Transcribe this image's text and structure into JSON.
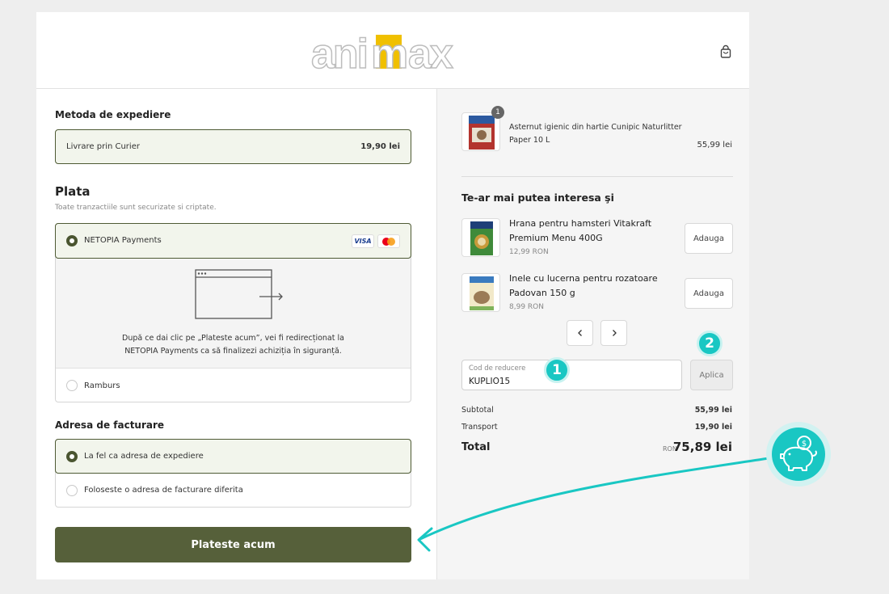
{
  "store": {
    "logo_text": "animax"
  },
  "shipping": {
    "title": "Metoda de expediere",
    "method": "Livrare prin Curier",
    "price": "19,90 lei"
  },
  "payment": {
    "title": "Plata",
    "subtitle": "Toate tranzactiile sunt securizate si criptate.",
    "options": [
      {
        "label": "NETOPIA Payments",
        "selected": true
      },
      {
        "label": "Ramburs",
        "selected": false
      }
    ],
    "cards": [
      "VISA",
      "mastercard"
    ],
    "redirect_note_line1": "După ce dai clic pe „Plateste acum”, vei fi redirecționat la",
    "redirect_note_line2": "NETOPIA Payments ca să finalizezi achiziția în siguranță."
  },
  "billing": {
    "title": "Adresa de facturare",
    "options": [
      {
        "label": "La fel ca adresa de expediere",
        "selected": true
      },
      {
        "label": "Foloseste o adresa de facturare diferita",
        "selected": false
      }
    ]
  },
  "pay_button": "Plateste acum",
  "order": {
    "item": {
      "quantity": "1",
      "name_line1": "Asternut igienic din hartie Cunipic Naturlitter",
      "name_line2": "Paper 10 L",
      "price": "55,99 lei"
    }
  },
  "upsell": {
    "title": "Te-ar mai putea interesa şi",
    "products": [
      {
        "name_line1": "Hrana pentru hamsteri Vitakraft",
        "name_line2": "Premium Menu 400G",
        "price": "12,99 RON",
        "button": "Adauga"
      },
      {
        "name_line1": "Inele cu lucerna pentru rozatoare",
        "name_line2": "Padovan 150 g",
        "price": "8,99 RON",
        "button": "Adauga"
      }
    ]
  },
  "discount": {
    "label": "Cod de reducere",
    "value": "KUPLIO15",
    "apply_button": "Aplica"
  },
  "summary": {
    "subtotal_label": "Subtotal",
    "subtotal_value": "55,99 lei",
    "transport_label": "Transport",
    "transport_value": "19,90 lei",
    "total_label": "Total",
    "total_currency": "RON",
    "total_value": "75,89 lei"
  },
  "annotations": {
    "marker1": "1",
    "marker2": "2"
  },
  "colors": {
    "accent_green": "#56603a",
    "annotation_teal": "#19c7c3"
  }
}
